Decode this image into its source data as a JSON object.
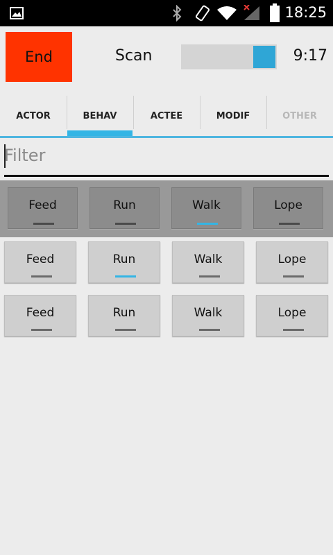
{
  "status_bar": {
    "time": "18:25"
  },
  "top": {
    "end_label": "End",
    "scan_label": "Scan",
    "timer": "9:17",
    "slider_level": 0.95
  },
  "tabs": [
    {
      "label": "ACTOR",
      "enabled": true
    },
    {
      "label": "BEHAV",
      "enabled": true,
      "selected": true
    },
    {
      "label": "ACTEE",
      "enabled": true
    },
    {
      "label": "MODIF",
      "enabled": true
    },
    {
      "label": "OTHER",
      "enabled": false
    }
  ],
  "filter": {
    "placeholder": "Filter",
    "value": ""
  },
  "rows": [
    {
      "items": [
        {
          "label": "Feed",
          "active": false
        },
        {
          "label": "Run",
          "active": false
        },
        {
          "label": "Walk",
          "active": true
        },
        {
          "label": "Lope",
          "active": false
        }
      ]
    },
    {
      "items": [
        {
          "label": "Feed",
          "active": false
        },
        {
          "label": "Run",
          "active": true
        },
        {
          "label": "Walk",
          "active": false
        },
        {
          "label": "Lope",
          "active": false
        }
      ]
    },
    {
      "items": [
        {
          "label": "Feed",
          "active": false
        },
        {
          "label": "Run",
          "active": false
        },
        {
          "label": "Walk",
          "active": false
        },
        {
          "label": "Lope",
          "active": false
        }
      ]
    }
  ],
  "colors": {
    "end_button": "#ff3300",
    "accent": "#33b5e5",
    "highlight_row": "#999999"
  }
}
